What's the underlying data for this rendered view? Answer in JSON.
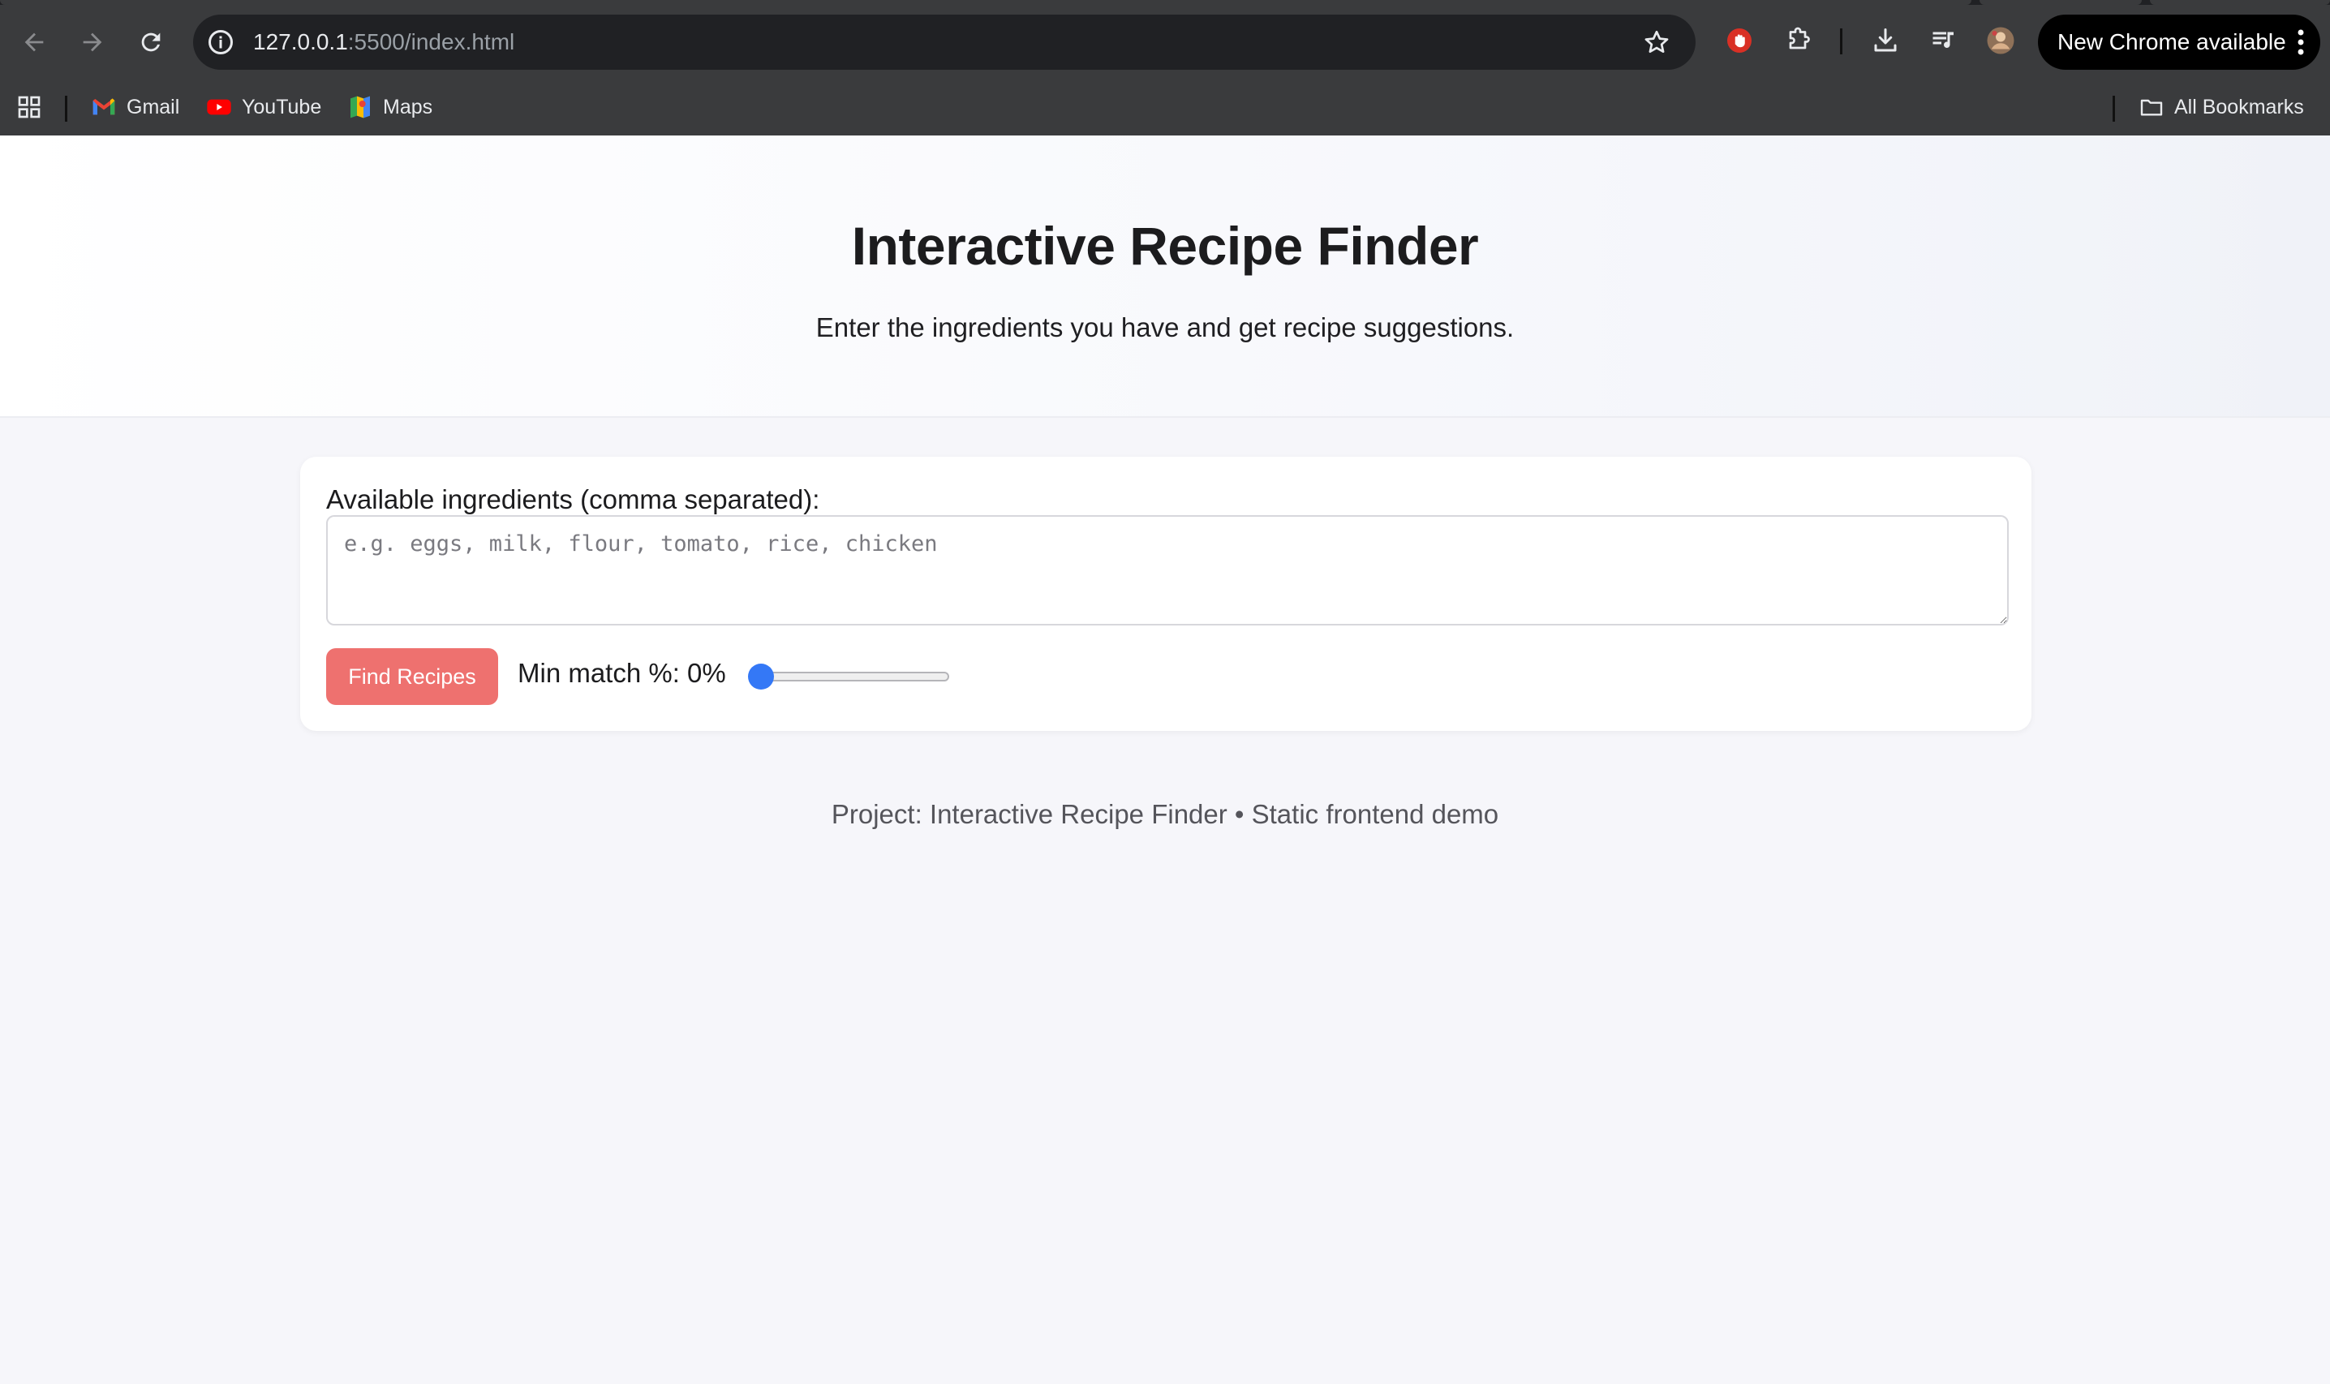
{
  "browser": {
    "url_host": "127.0.0.1",
    "url_path": ":5500/index.html",
    "update_button_label": "New Chrome available",
    "bookmarks": [
      {
        "label": "Gmail",
        "icon": "gmail-icon"
      },
      {
        "label": "YouTube",
        "icon": "youtube-icon"
      },
      {
        "label": "Maps",
        "icon": "maps-icon"
      }
    ],
    "all_bookmarks_label": "All Bookmarks"
  },
  "hero": {
    "title": "Interactive Recipe Finder",
    "subtitle": "Enter the ingredients you have and get recipe suggestions."
  },
  "form": {
    "ingredients_label": "Available ingredients (comma separated):",
    "ingredients_placeholder": "e.g. eggs, milk, flour, tomato, rice, chicken",
    "ingredients_value": "",
    "find_button_label": "Find Recipes",
    "min_match_label": "Min match %: 0%",
    "min_match_value": 0,
    "find_button_color": "#ee716f",
    "slider_color": "#3478f6"
  },
  "footer": {
    "text": "Project: Interactive Recipe Finder • Static frontend demo"
  }
}
